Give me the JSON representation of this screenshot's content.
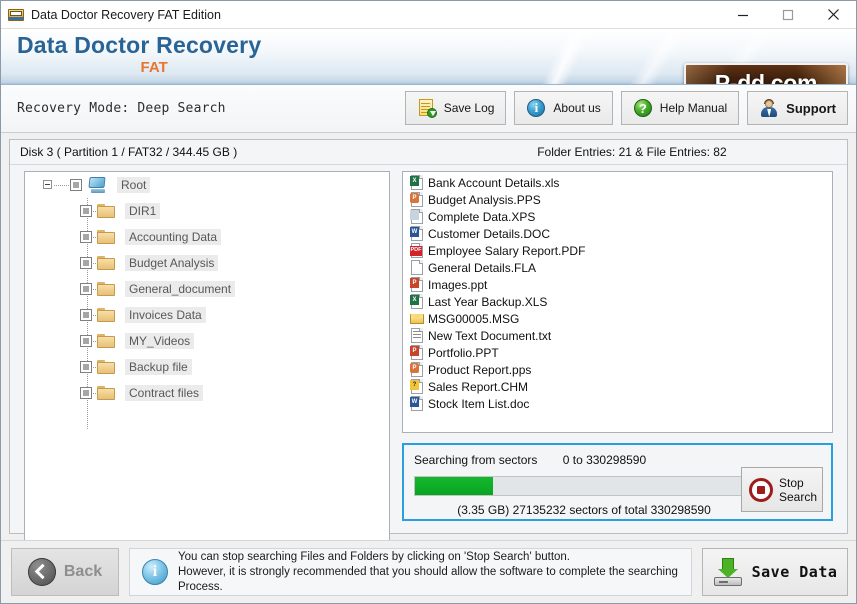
{
  "window": {
    "title": "Data Doctor Recovery FAT Edition",
    "icon": "app-icon",
    "minimize": "—",
    "maximize": "□",
    "close": "✕"
  },
  "banner": {
    "brand_main": "Data Doctor Recovery",
    "brand_sub": "FAT",
    "logo_text": "P-dd.com",
    "accent_blue": "#2a6496",
    "accent_orange": "#e8762c"
  },
  "toolbar": {
    "recovery_mode": "Recovery Mode:  Deep Search",
    "buttons": [
      {
        "label": "Save Log",
        "icon": "save-log-icon"
      },
      {
        "label": "About us",
        "icon": "info-circle-icon"
      },
      {
        "label": "Help Manual",
        "icon": "question-circle-icon"
      },
      {
        "label": "Support",
        "icon": "support-person-icon"
      }
    ]
  },
  "disk": {
    "label": "Disk 3 ( Partition 1 / FAT32 / 344.45 GB )",
    "entries": "Folder Entries: 21 & File Entries: 82"
  },
  "tree": {
    "root": {
      "label": "Root",
      "icon": "computer-icon",
      "expander": "minus"
    },
    "folders": [
      {
        "label": "DIR1"
      },
      {
        "label": "Accounting Data"
      },
      {
        "label": "Budget Analysis"
      },
      {
        "label": "General_document"
      },
      {
        "label": "Invoices Data"
      },
      {
        "label": "MY_Videos"
      },
      {
        "label": "Backup file"
      },
      {
        "label": "Contract files"
      }
    ]
  },
  "files": [
    {
      "name": "Bank Account Details.xls",
      "type": "xls",
      "badge": "X"
    },
    {
      "name": "Budget Analysis.PPS",
      "type": "pps",
      "badge": "P"
    },
    {
      "name": "Complete Data.XPS",
      "type": "xps",
      "badge": ""
    },
    {
      "name": "Customer Details.DOC",
      "type": "doc",
      "badge": "W"
    },
    {
      "name": "Employee Salary Report.PDF",
      "type": "pdf",
      "badge": "PDF"
    },
    {
      "name": "General Details.FLA",
      "type": "blank",
      "badge": ""
    },
    {
      "name": "Images.ppt",
      "type": "ppt",
      "badge": "P"
    },
    {
      "name": "Last Year Backup.XLS",
      "type": "xls",
      "badge": "X"
    },
    {
      "name": "MSG00005.MSG",
      "type": "msg",
      "badge": ""
    },
    {
      "name": "New Text Document.txt",
      "type": "txt",
      "badge": ""
    },
    {
      "name": "Portfolio.PPT",
      "type": "ppt",
      "badge": "P"
    },
    {
      "name": "Product Report.pps",
      "type": "pps",
      "badge": "P"
    },
    {
      "name": "Sales Report.CHM",
      "type": "chm",
      "badge": "?"
    },
    {
      "name": "Stock Item List.doc",
      "type": "doc",
      "badge": "W"
    }
  ],
  "search": {
    "title": "Searching from sectors",
    "range": "0 to 330298590",
    "progress_percent": 23,
    "progress_color": "#0ea524",
    "footer": "(3.35 GB) 27135232  sectors  of  total 330298590",
    "stop_button_line1": "Stop",
    "stop_button_line2": "Search",
    "border_color": "#2a9fe0"
  },
  "bottom": {
    "back_label": "Back",
    "info_line1": "You can stop searching Files and Folders by clicking on 'Stop Search' button.",
    "info_line2": "However, it is strongly recommended that you should allow the software to complete the searching",
    "info_line3": "Process.",
    "save_data_label": "Save Data"
  }
}
